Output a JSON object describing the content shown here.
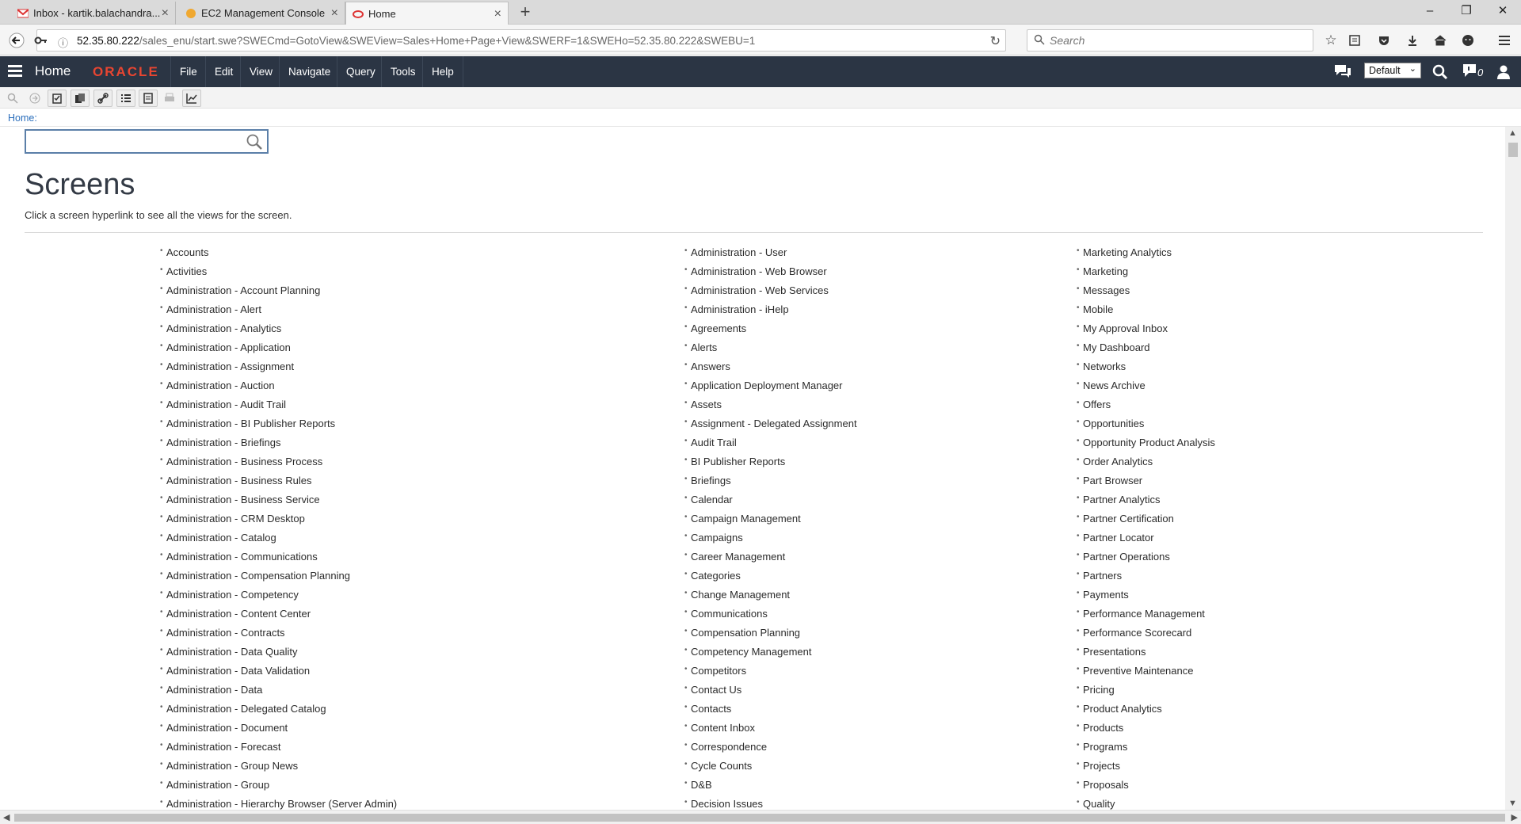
{
  "browser": {
    "tabs": [
      {
        "label": "Inbox - kartik.balachandra...",
        "icon": "gmail-icon",
        "active": false
      },
      {
        "label": "EC2 Management Console",
        "icon": "aws-icon",
        "active": false
      },
      {
        "label": "Home",
        "icon": "oracle-icon",
        "active": true
      }
    ],
    "url_prefix": "52.35.80.222",
    "url_rest": "/sales_enu/start.swe?SWECmd=GotoView&SWEView=Sales+Home+Page+View&SWERF=1&SWEHo=52.35.80.222&SWEBU=1",
    "search_placeholder": "Search"
  },
  "app": {
    "title": "Home",
    "brand": "ORACLE",
    "brand_color": "#e84531",
    "header_bg": "#2b3544",
    "menu": [
      "File",
      "Edit",
      "View",
      "Navigate",
      "Query",
      "Tools",
      "Help"
    ],
    "layout_select": "Default",
    "notifications_count": "0"
  },
  "breadcrumb": "Home:",
  "page": {
    "title": "Screens",
    "subtitle": "Click a screen hyperlink to see all the views for the screen."
  },
  "screens": {
    "col1": [
      "Accounts",
      "Activities",
      "Administration - Account Planning",
      "Administration - Alert",
      "Administration - Analytics",
      "Administration - Application",
      "Administration - Assignment",
      "Administration - Auction",
      "Administration - Audit Trail",
      "Administration - BI Publisher Reports",
      "Administration - Briefings",
      "Administration - Business Process",
      "Administration - Business Rules",
      "Administration - Business Service",
      "Administration - CRM Desktop",
      "Administration - Catalog",
      "Administration - Communications",
      "Administration - Compensation Planning",
      "Administration - Competency",
      "Administration - Content Center",
      "Administration - Contracts",
      "Administration - Data Quality",
      "Administration - Data Validation",
      "Administration - Data",
      "Administration - Delegated Catalog",
      "Administration - Document",
      "Administration - Forecast",
      "Administration - Group News",
      "Administration - Group",
      "Administration - Hierarchy Browser (Server Admin)"
    ],
    "col2": [
      "Administration - User",
      "Administration - Web Browser",
      "Administration - Web Services",
      "Administration - iHelp",
      "Agreements",
      "Alerts",
      "Answers",
      "Application Deployment Manager",
      "Assets",
      "Assignment - Delegated Assignment",
      "Audit Trail",
      "BI Publisher Reports",
      "Briefings",
      "Calendar",
      "Campaign Management",
      "Campaigns",
      "Career Management",
      "Categories",
      "Change Management",
      "Communications",
      "Compensation Planning",
      "Competency Management",
      "Competitors",
      "Contact Us",
      "Contacts",
      "Content Inbox",
      "Correspondence",
      "Cycle Counts",
      "D&B",
      "Decision Issues"
    ],
    "col3": [
      "Marketing Analytics",
      "Marketing",
      "Messages",
      "Mobile",
      "My Approval Inbox",
      "My Dashboard",
      "Networks",
      "News Archive",
      "Offers",
      "Opportunities",
      "Opportunity Product Analysis",
      "Order Analytics",
      "Part Browser",
      "Partner Analytics",
      "Partner Certification",
      "Partner Locator",
      "Partner Operations",
      "Partners",
      "Payments",
      "Performance Management",
      "Performance Scorecard",
      "Presentations",
      "Preventive Maintenance",
      "Pricing",
      "Product Analytics",
      "Products",
      "Programs",
      "Projects",
      "Proposals",
      "Quality"
    ]
  }
}
